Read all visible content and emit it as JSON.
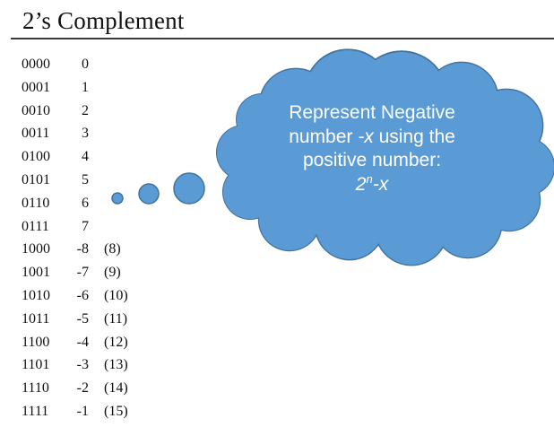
{
  "slide": {
    "title": "2’s Complement",
    "table": [
      {
        "binary": "0000",
        "value": "0",
        "unsigned": ""
      },
      {
        "binary": "0001",
        "value": "1",
        "unsigned": ""
      },
      {
        "binary": "0010",
        "value": "2",
        "unsigned": ""
      },
      {
        "binary": "0011",
        "value": "3",
        "unsigned": ""
      },
      {
        "binary": "0100",
        "value": "4",
        "unsigned": ""
      },
      {
        "binary": "0101",
        "value": "5",
        "unsigned": ""
      },
      {
        "binary": "0110",
        "value": "6",
        "unsigned": ""
      },
      {
        "binary": "0111",
        "value": "7",
        "unsigned": ""
      },
      {
        "binary": "1000",
        "value": "-8",
        "unsigned": "(8)"
      },
      {
        "binary": "1001",
        "value": "-7",
        "unsigned": "(9)"
      },
      {
        "binary": "1010",
        "value": "-6",
        "unsigned": "(10)"
      },
      {
        "binary": "1011",
        "value": "-5",
        "unsigned": "(11)"
      },
      {
        "binary": "1100",
        "value": "-4",
        "unsigned": "(12)"
      },
      {
        "binary": "1101",
        "value": "-3",
        "unsigned": "(13)"
      },
      {
        "binary": "1110",
        "value": "-2",
        "unsigned": "(14)"
      },
      {
        "binary": "1111",
        "value": "-1",
        "unsigned": "(15)"
      }
    ],
    "callout": {
      "line1": "Represent Negative",
      "line2_pre": "number ",
      "line2_var": "-x",
      "line2_post": " using the",
      "line3": "positive number:",
      "formula_base": "2",
      "formula_exp": "n",
      "formula_rest": "-x"
    },
    "colors": {
      "cloud_fill": "#5b9bd5",
      "cloud_stroke": "#41719c",
      "rule": "#3a3a3a"
    }
  }
}
